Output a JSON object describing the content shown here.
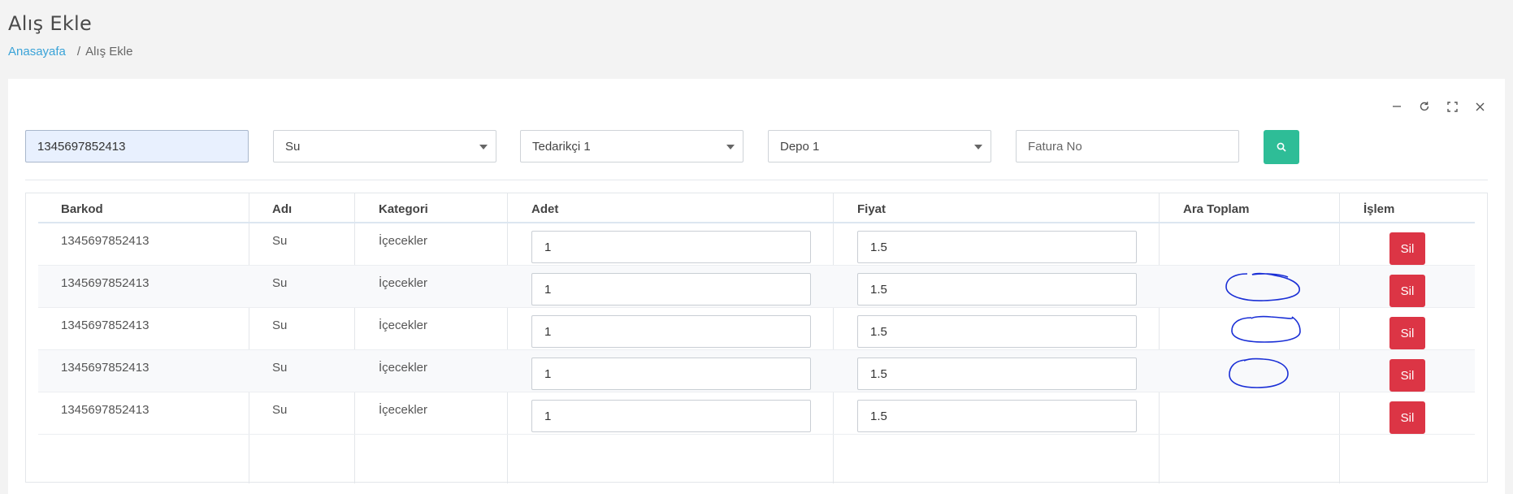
{
  "page": {
    "title": "Alış Ekle",
    "breadcrumb": {
      "home": "Anasayafa",
      "separator": "/",
      "current": "Alış Ekle"
    }
  },
  "card_tools": [
    "minimize-icon",
    "refresh-icon",
    "fullscreen-icon",
    "close-icon"
  ],
  "filters": {
    "barcode_value": "1345697852413",
    "product_selected": "Su",
    "supplier_selected": "Tedarikçi 1",
    "warehouse_selected": "Depo 1",
    "invoice_placeholder": "Fatura No",
    "search_icon": "search-icon"
  },
  "table": {
    "columns": [
      "Barkod",
      "Adı",
      "Kategori",
      "Adet",
      "Fiyat",
      "Ara Toplam",
      "İşlem"
    ],
    "rows": [
      {
        "barkod": "1345697852413",
        "adi": "Su",
        "kategori": "İçecekler",
        "adet": "1",
        "fiyat": "1.5",
        "ara_toplam": "",
        "islem": "Sil"
      },
      {
        "barkod": "1345697852413",
        "adi": "Su",
        "kategori": "İçecekler",
        "adet": "1",
        "fiyat": "1.5",
        "ara_toplam": "",
        "islem": "Sil"
      },
      {
        "barkod": "1345697852413",
        "adi": "Su",
        "kategori": "İçecekler",
        "adet": "1",
        "fiyat": "1.5",
        "ara_toplam": "",
        "islem": "Sil"
      },
      {
        "barkod": "1345697852413",
        "adi": "Su",
        "kategori": "İçecekler",
        "adet": "1",
        "fiyat": "1.5",
        "ara_toplam": "",
        "islem": "Sil"
      },
      {
        "barkod": "1345697852413",
        "adi": "Su",
        "kategori": "İçecekler",
        "adet": "1",
        "fiyat": "1.5",
        "ara_toplam": "",
        "islem": "Sil"
      }
    ]
  },
  "colors": {
    "link": "#3aa3d8",
    "search_button": "#2ebd97",
    "delete_button": "#dc3545",
    "annotation_ink": "#1a2fd6"
  }
}
